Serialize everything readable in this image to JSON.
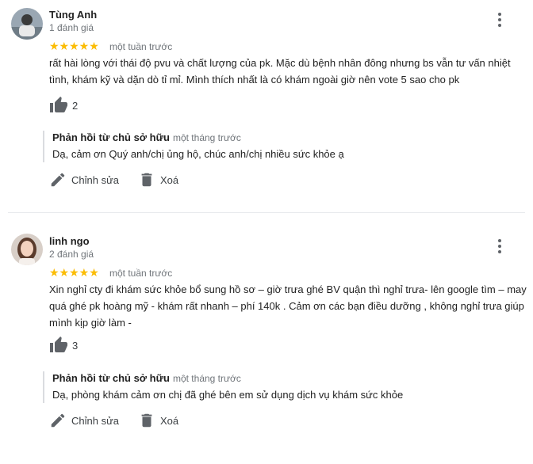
{
  "reviews": [
    {
      "name": "Tùng Anh",
      "review_count": "1 đánh giá",
      "stars": "★★★★★",
      "time": "một tuần trước",
      "text_line1": "rất hài lòng với thái độ pvu và chất lượng của pk. Mặc dù bệnh nhân đông nhưng bs vẫn tư vấn nhiệt",
      "text_line2": "tình, khám kỹ và dặn dò tỉ mỉ. Mình thích nhất là có khám ngoài giờ nên vote 5 sao cho pk",
      "likes": "2",
      "reply_title": "Phản hồi từ chủ sở hữu",
      "reply_time": "một tháng trước",
      "reply_text": "Dạ, cảm ơn Quý anh/chị ủng hộ, chúc anh/chị nhiều sức khỏe ạ",
      "edit_label": "Chỉnh sửa",
      "delete_label": "Xoá"
    },
    {
      "name": "linh ngo",
      "review_count": "2 đánh giá",
      "stars": "★★★★★",
      "time": "một tuần trước",
      "text_line1": "Xin nghỉ cty đi khám sức khỏe bổ sung hồ sơ – giờ trưa ghé BV quận thì nghỉ trưa- lên google tìm – may",
      "text_line2": "quá ghé pk hoàng mỹ - khám rất nhanh – phí 140k . Cảm ơn các bạn điều dưỡng , không nghỉ trưa giúp",
      "text_line3": "mình kịp giờ làm -",
      "likes": "3",
      "reply_title": "Phản hồi từ chủ sở hữu",
      "reply_time": "một tháng trước",
      "reply_text": "Dạ, phòng khám cảm ơn chị đã ghé bên em sử dụng dịch vụ khám sức khỏe",
      "edit_label": "Chỉnh sửa",
      "delete_label": "Xoá"
    }
  ],
  "colors": {
    "star": "#fbbc04",
    "secondary_text": "#70757a",
    "icon": "#5f6368"
  },
  "icons": [
    "avatar",
    "more-vert-icon",
    "thumb-up-icon",
    "pencil-icon",
    "trash-icon"
  ]
}
